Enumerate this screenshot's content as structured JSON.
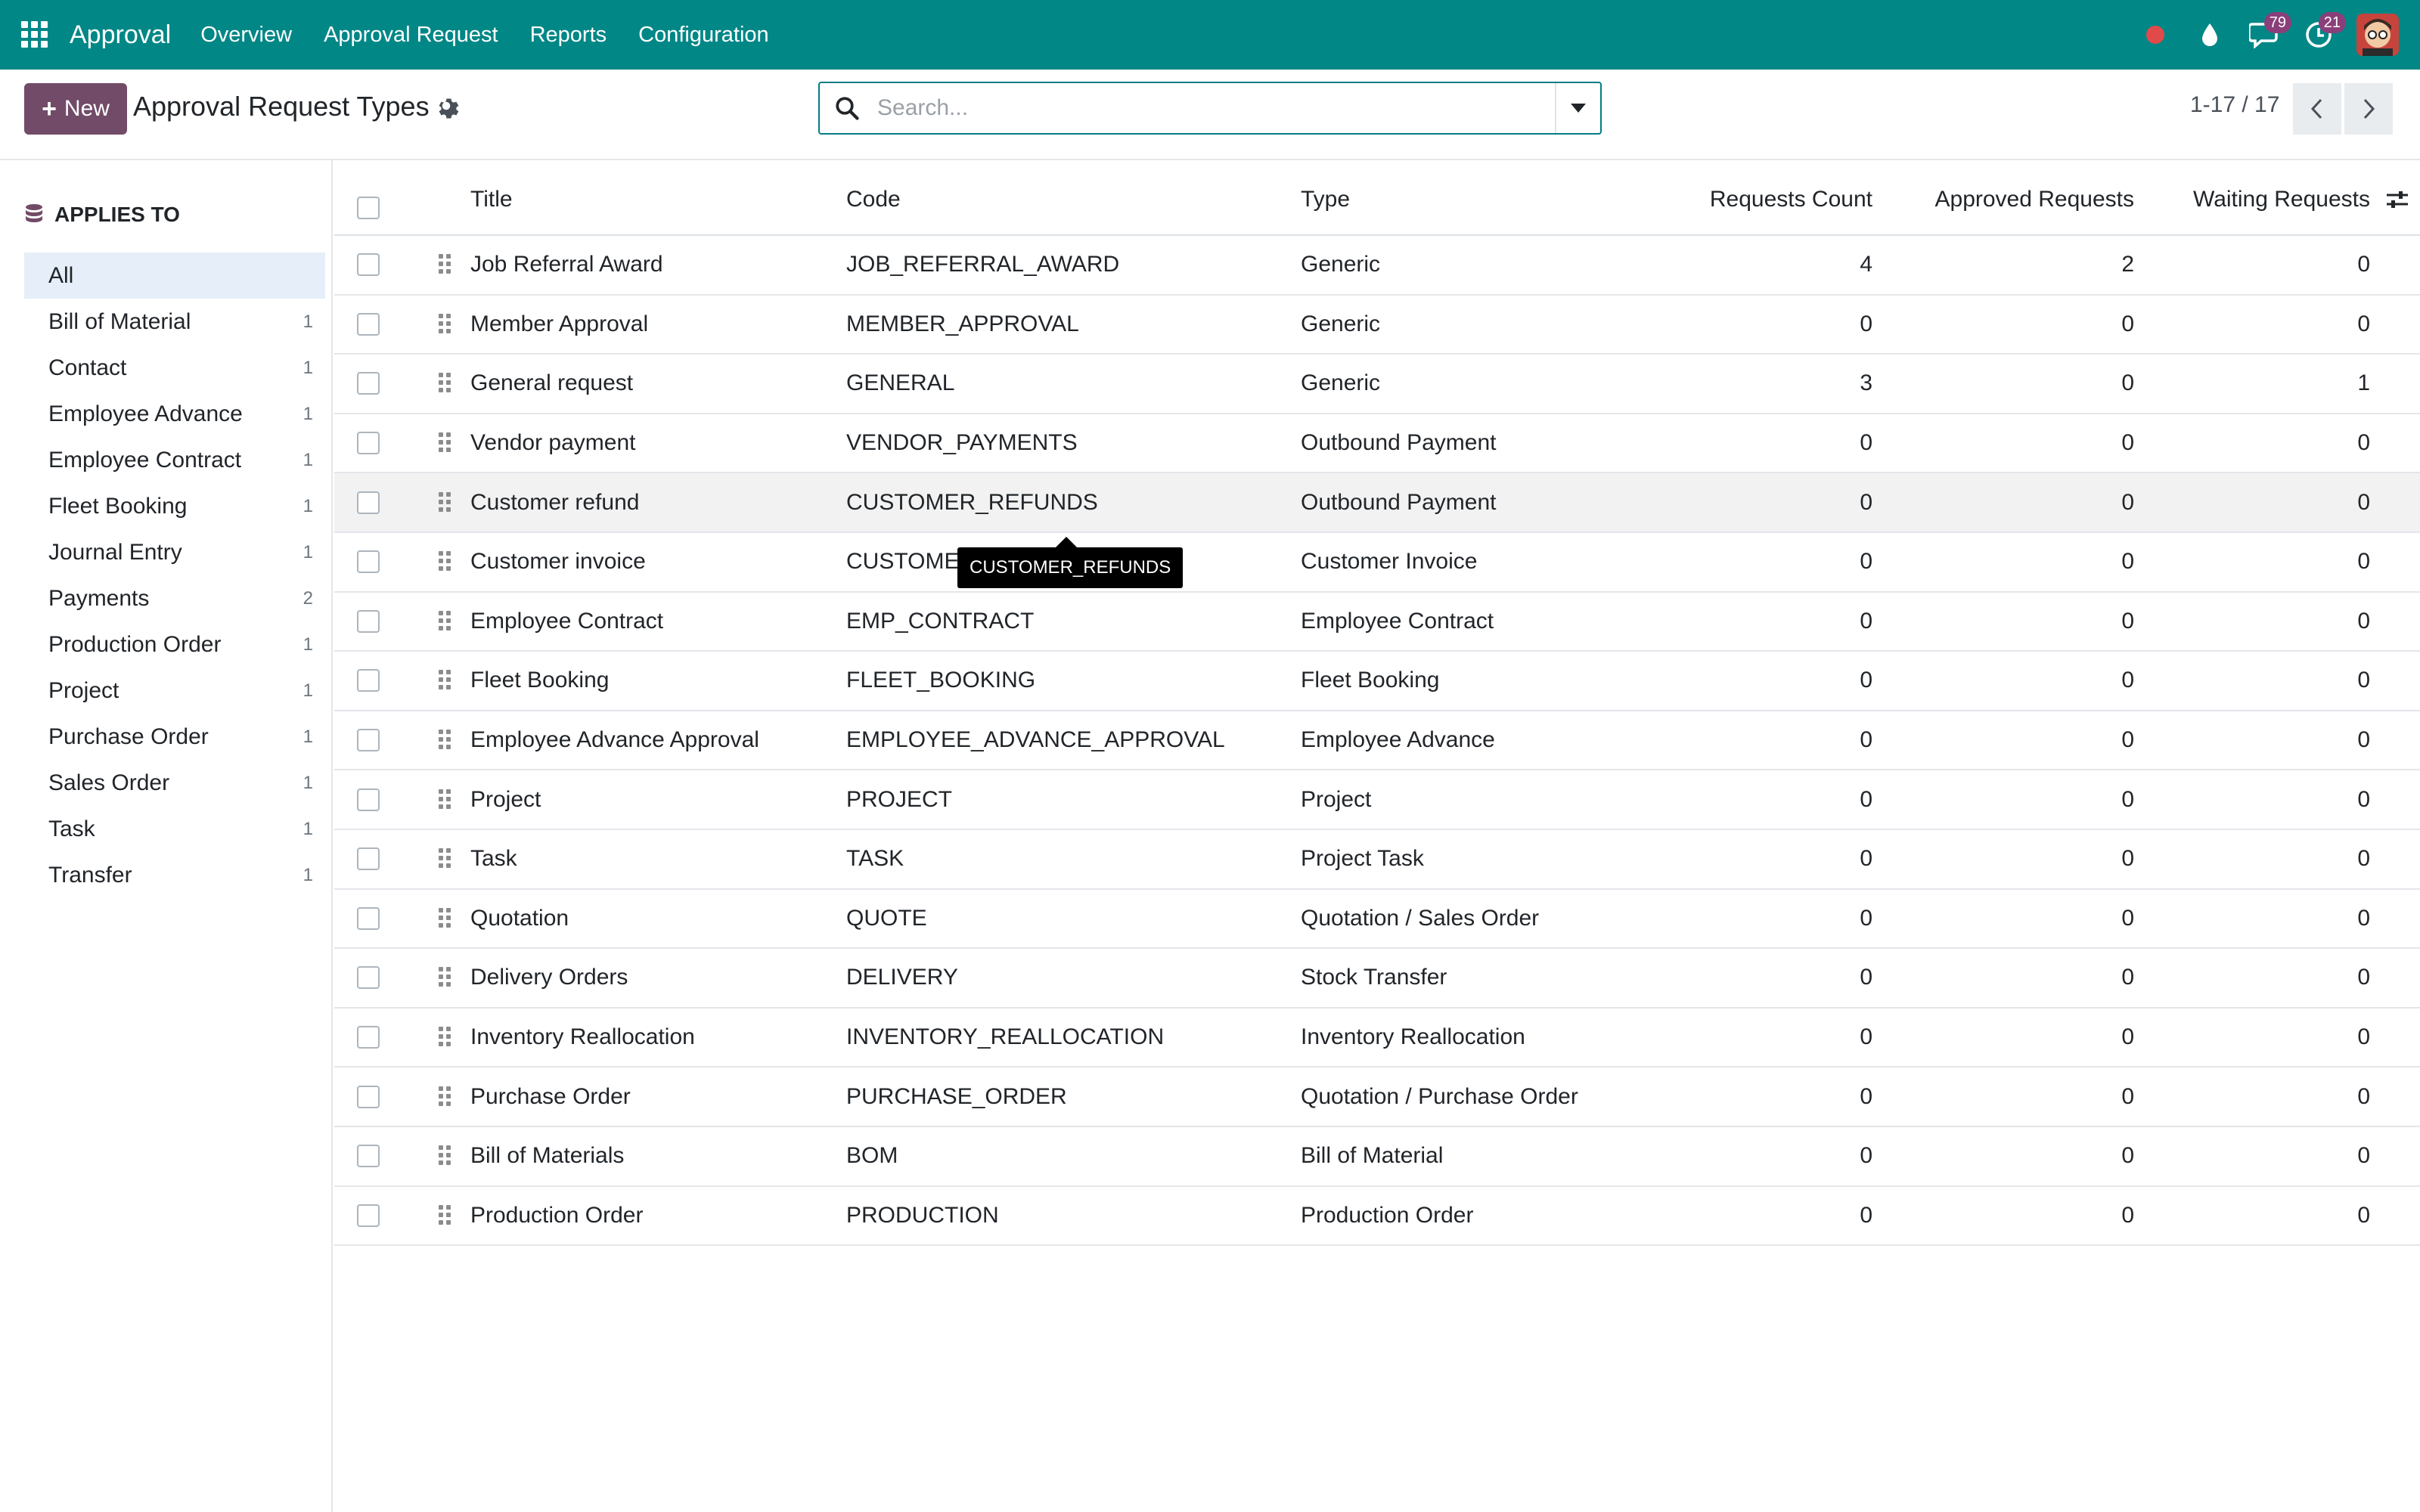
{
  "app": {
    "brand": "Approval",
    "menu": [
      {
        "label": "Overview"
      },
      {
        "label": "Approval Request"
      },
      {
        "label": "Reports"
      },
      {
        "label": "Configuration"
      }
    ],
    "messages_count": "79",
    "activities_count": "21"
  },
  "control_panel": {
    "new_label": "New",
    "title": "Approval Request Types",
    "search_placeholder": "Search...",
    "pager": "1-17 / 17"
  },
  "sidebar": {
    "header": "APPLIES TO",
    "items": [
      {
        "label": "All",
        "count": ""
      },
      {
        "label": "Bill of Material",
        "count": "1"
      },
      {
        "label": "Contact",
        "count": "1"
      },
      {
        "label": "Employee Advance",
        "count": "1"
      },
      {
        "label": "Employee Contract",
        "count": "1"
      },
      {
        "label": "Fleet Booking",
        "count": "1"
      },
      {
        "label": "Journal Entry",
        "count": "1"
      },
      {
        "label": "Payments",
        "count": "2"
      },
      {
        "label": "Production Order",
        "count": "1"
      },
      {
        "label": "Project",
        "count": "1"
      },
      {
        "label": "Purchase Order",
        "count": "1"
      },
      {
        "label": "Sales Order",
        "count": "1"
      },
      {
        "label": "Task",
        "count": "1"
      },
      {
        "label": "Transfer",
        "count": "1"
      }
    ]
  },
  "table": {
    "columns": {
      "title": "Title",
      "code": "Code",
      "type": "Type",
      "requests": "Requests Count",
      "approved": "Approved Requests",
      "waiting": "Waiting Requests"
    },
    "rows": [
      {
        "title": "Job Referral Award",
        "code": "JOB_REFERRAL_AWARD",
        "type": "Generic",
        "requests": "4",
        "approved": "2",
        "waiting": "0"
      },
      {
        "title": "Member Approval",
        "code": "MEMBER_APPROVAL",
        "type": "Generic",
        "requests": "0",
        "approved": "0",
        "waiting": "0"
      },
      {
        "title": "General request",
        "code": "GENERAL",
        "type": "Generic",
        "requests": "3",
        "approved": "0",
        "waiting": "1"
      },
      {
        "title": "Vendor payment",
        "code": "VENDOR_PAYMENTS",
        "type": "Outbound Payment",
        "requests": "0",
        "approved": "0",
        "waiting": "0"
      },
      {
        "title": "Customer refund",
        "code": "CUSTOMER_REFUNDS",
        "type": "Outbound Payment",
        "requests": "0",
        "approved": "0",
        "waiting": "0"
      },
      {
        "title": "Customer invoice",
        "code": "CUSTOMEI",
        "type": "Customer Invoice",
        "requests": "0",
        "approved": "0",
        "waiting": "0"
      },
      {
        "title": "Employee Contract",
        "code": "EMP_CONTRACT",
        "type": "Employee Contract",
        "requests": "0",
        "approved": "0",
        "waiting": "0"
      },
      {
        "title": "Fleet Booking",
        "code": "FLEET_BOOKING",
        "type": "Fleet Booking",
        "requests": "0",
        "approved": "0",
        "waiting": "0"
      },
      {
        "title": "Employee Advance Approval",
        "code": "EMPLOYEE_ADVANCE_APPROVAL",
        "type": "Employee Advance",
        "requests": "0",
        "approved": "0",
        "waiting": "0"
      },
      {
        "title": "Project",
        "code": "PROJECT",
        "type": "Project",
        "requests": "0",
        "approved": "0",
        "waiting": "0"
      },
      {
        "title": "Task",
        "code": "TASK",
        "type": "Project Task",
        "requests": "0",
        "approved": "0",
        "waiting": "0"
      },
      {
        "title": "Quotation",
        "code": "QUOTE",
        "type": "Quotation / Sales Order",
        "requests": "0",
        "approved": "0",
        "waiting": "0"
      },
      {
        "title": "Delivery Orders",
        "code": "DELIVERY",
        "type": "Stock Transfer",
        "requests": "0",
        "approved": "0",
        "waiting": "0"
      },
      {
        "title": "Inventory Reallocation",
        "code": "INVENTORY_REALLOCATION",
        "type": "Inventory Reallocation",
        "requests": "0",
        "approved": "0",
        "waiting": "0"
      },
      {
        "title": "Purchase Order",
        "code": "PURCHASE_ORDER",
        "type": "Quotation / Purchase Order",
        "requests": "0",
        "approved": "0",
        "waiting": "0"
      },
      {
        "title": "Bill of Materials",
        "code": "BOM",
        "type": "Bill of Material",
        "requests": "0",
        "approved": "0",
        "waiting": "0"
      },
      {
        "title": "Production Order",
        "code": "PRODUCTION",
        "type": "Production Order",
        "requests": "0",
        "approved": "0",
        "waiting": "0"
      }
    ]
  },
  "tooltip": {
    "text": "CUSTOMER_REFUNDS"
  },
  "colors": {
    "navbar": "#018786",
    "primary_button": "#714b67",
    "badge": "#8a3f7a",
    "record_dot": "#e04a4a"
  },
  "icons": [
    "apps-grid-icon",
    "record-icon",
    "drop-icon",
    "chat-icon",
    "clock-icon",
    "gear-icon",
    "search-icon",
    "caret-down-icon",
    "chevron-left-icon",
    "chevron-right-icon",
    "database-icon",
    "drag-handle-icon",
    "column-options-icon"
  ]
}
